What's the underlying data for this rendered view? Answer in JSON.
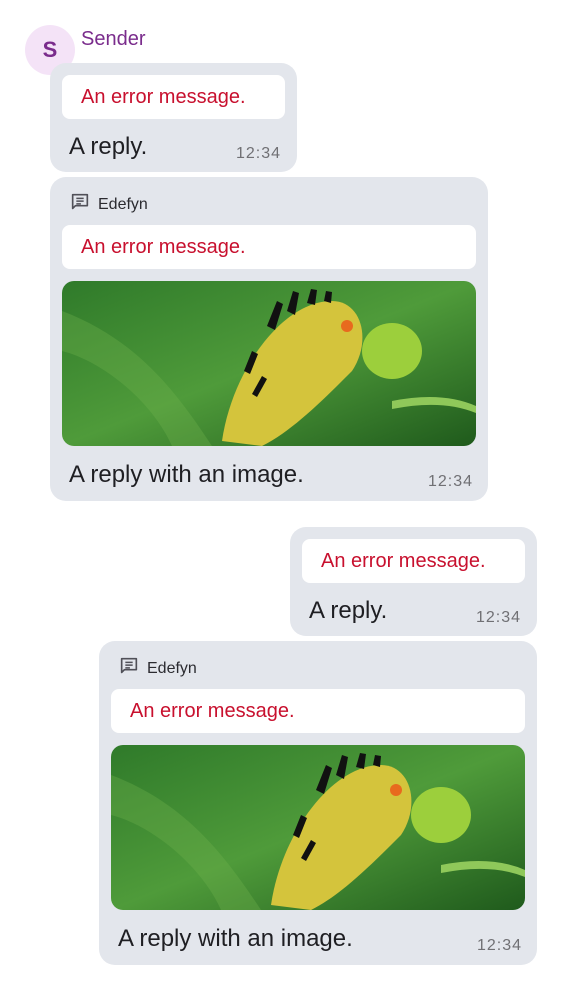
{
  "sender": {
    "initial": "S",
    "name": "Sender"
  },
  "messages": [
    {
      "error": "An error message.",
      "text": "A reply.",
      "time": "12:34"
    },
    {
      "thread": "Edefyn",
      "error": "An error message.",
      "image": "caterpillar-image",
      "text": "A reply with an image.",
      "time": "12:34"
    },
    {
      "error": "An error message.",
      "text": "A reply.",
      "time": "12:34"
    },
    {
      "thread": "Edefyn",
      "error": "An error message.",
      "image": "caterpillar-image",
      "text": "A reply with an image.",
      "time": "12:34"
    }
  ],
  "colors": {
    "bubble": "#e3e6ec",
    "error": "#c8102e",
    "sender": "#7a2c8c"
  }
}
